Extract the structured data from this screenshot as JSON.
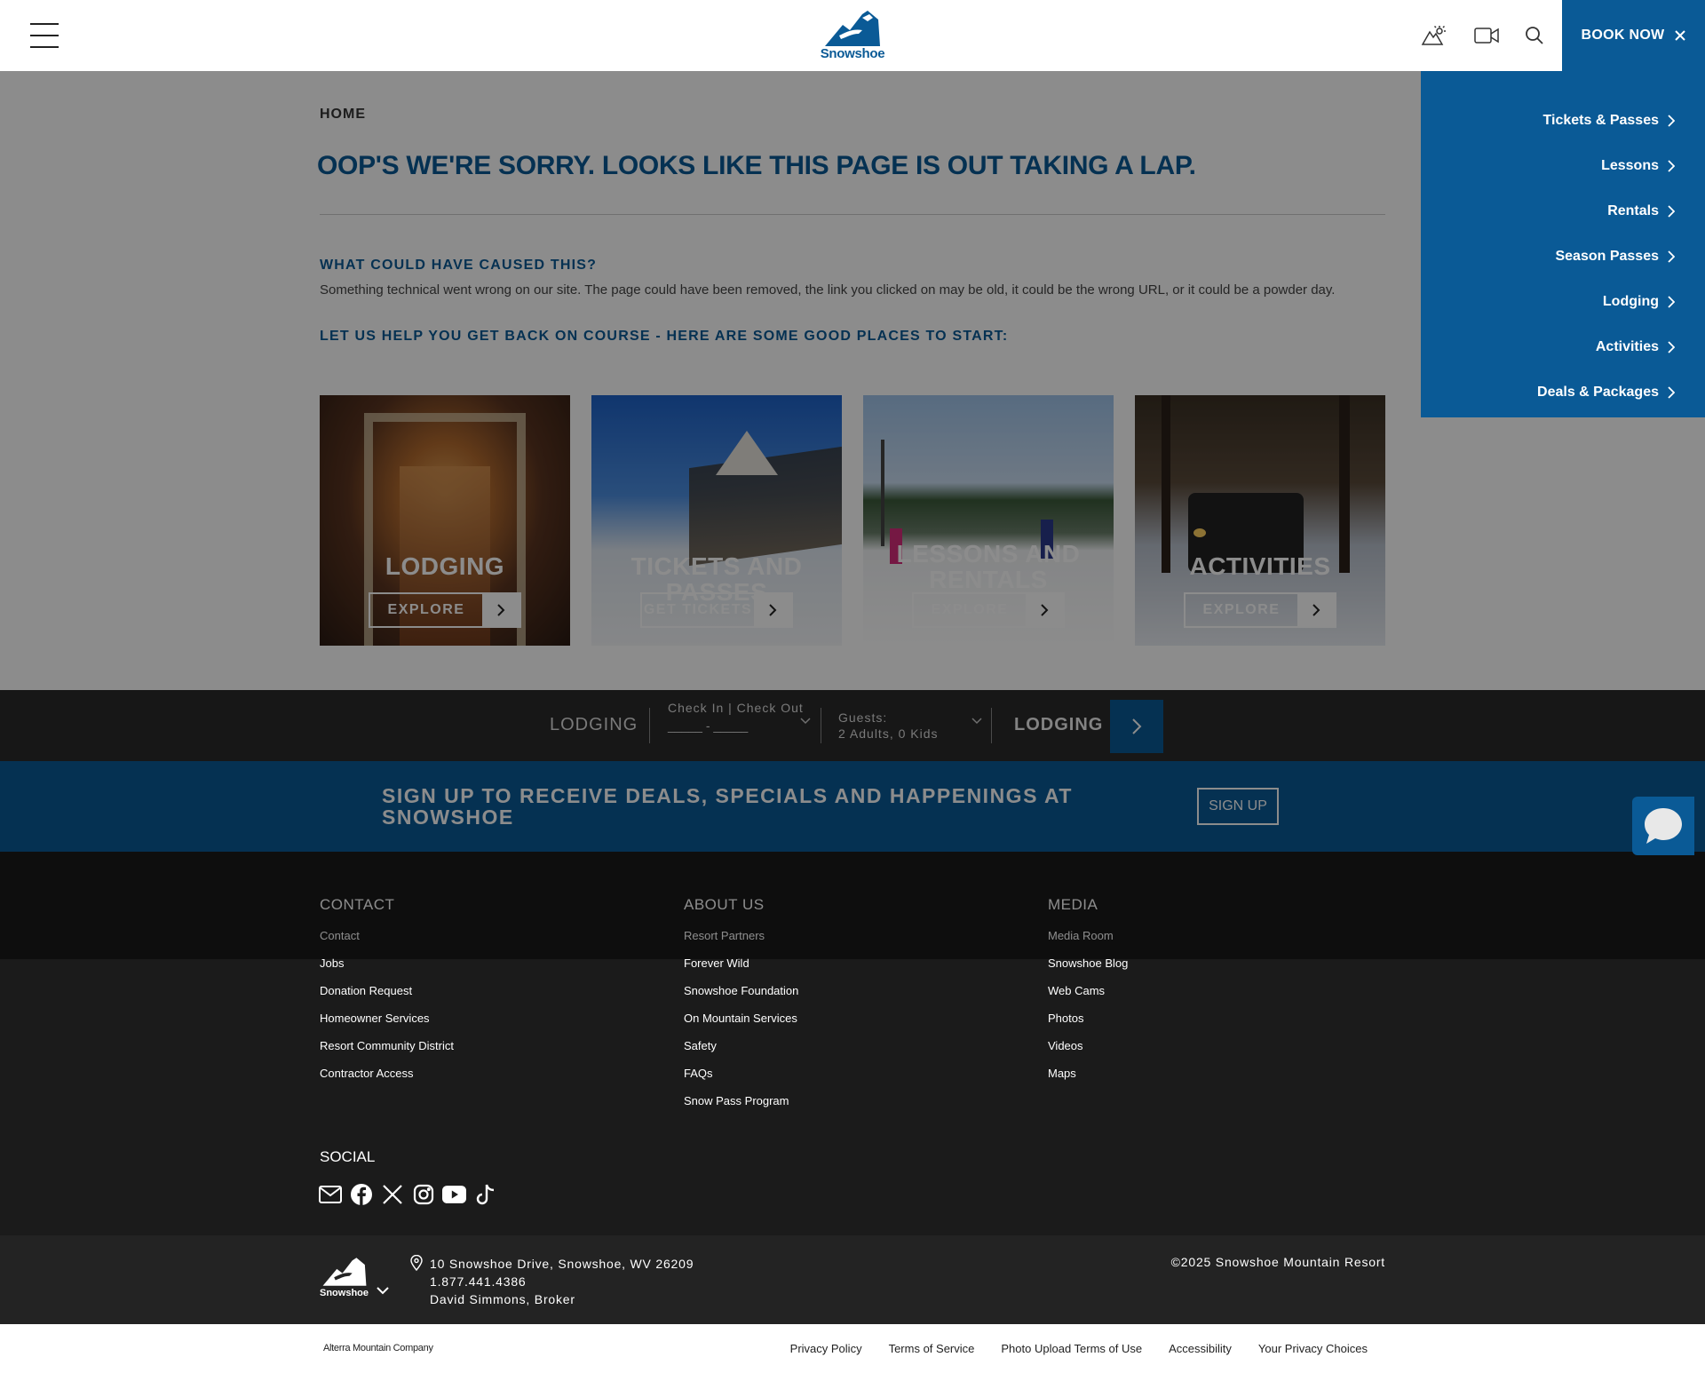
{
  "header": {
    "book_now_label": "BOOK NOW",
    "logo_text": "Snowshoe"
  },
  "dropdown": {
    "items": [
      {
        "label": "Tickets & Passes"
      },
      {
        "label": "Lessons"
      },
      {
        "label": "Rentals"
      },
      {
        "label": "Season Passes"
      },
      {
        "label": "Lodging"
      },
      {
        "label": "Activities"
      },
      {
        "label": "Deals & Packages"
      }
    ]
  },
  "main": {
    "breadcrumb": "HOME",
    "title": "OOP'S WE'RE SORRY. LOOKS LIKE THIS PAGE IS OUT TAKING A LAP.",
    "cause_heading": "WHAT COULD HAVE CAUSED THIS?",
    "cause_text": "Something technical went wrong on our site. The page could have been removed, the link you clicked on may be old, it could be the wrong URL, or it could be a powder day.",
    "help_heading": "LET US HELP YOU GET BACK ON COURSE - HERE ARE SOME GOOD PLACES TO START:",
    "cards": [
      {
        "title": "LODGING",
        "button": "EXPLORE"
      },
      {
        "title": "TICKETS AND PASSES",
        "button": "GET TICKETS"
      },
      {
        "title": "LESSONS AND RENTALS",
        "button": "EXPLORE"
      },
      {
        "title": "ACTIVITIES",
        "button": "EXPLORE"
      }
    ]
  },
  "lodging_bar": {
    "label": "LODGING",
    "check_label": "Check In | Check Out",
    "dates": "_____ - _____",
    "guests_label": "Guests:",
    "guests_value": "2 Adults, 0 Kids",
    "action_label": "LODGING"
  },
  "signup": {
    "text": "SIGN UP TO RECEIVE DEALS, SPECIALS AND HAPPENINGS AT SNOWSHOE",
    "button": "SIGN UP"
  },
  "footer": {
    "columns": [
      {
        "title": "CONTACT",
        "links": [
          "Contact",
          "Jobs",
          "Donation Request",
          "Homeowner Services",
          "Resort Community District",
          "Contractor Access"
        ]
      },
      {
        "title": "ABOUT US",
        "links": [
          "Resort Partners",
          "Forever Wild",
          "Snowshoe Foundation",
          "On Mountain Services",
          "Safety",
          "FAQs",
          "Snow Pass Program"
        ]
      },
      {
        "title": "MEDIA",
        "links": [
          "Media Room",
          "Snowshoe Blog",
          "Web Cams",
          "Photos",
          "Videos",
          "Maps"
        ]
      }
    ],
    "social_title": "SOCIAL",
    "social_icons": [
      "email-icon",
      "facebook-icon",
      "x-icon",
      "instagram-icon",
      "youtube-icon",
      "tiktok-icon"
    ],
    "logo_text": "Snowshoe",
    "address": "10 Snowshoe Drive, Snowshoe, WV 26209",
    "phone": "1.877.441.4386",
    "broker": "David Simmons, Broker",
    "copyright": "©2025 Snowshoe Mountain Resort"
  },
  "legal": {
    "company": "Alterra Mountain Company",
    "links": [
      "Privacy Policy",
      "Terms of Service",
      "Photo Upload Terms of Use",
      "Accessibility",
      "Your Privacy Choices"
    ]
  },
  "colors": {
    "brand_blue": "#0a5a96",
    "footer_dark": "#1b1b1b"
  }
}
